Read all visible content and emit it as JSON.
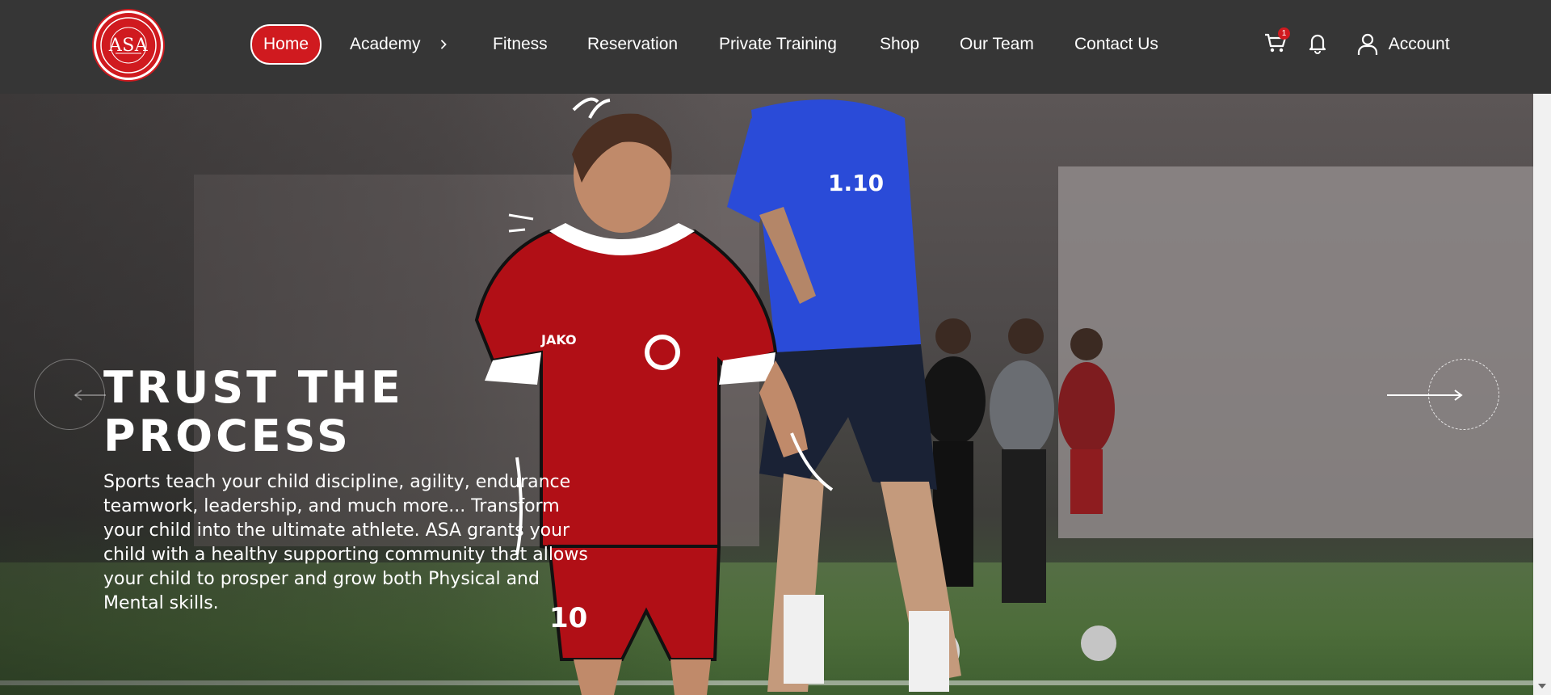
{
  "brand": {
    "logo_text": "ASA",
    "logo_ring_text": "ADVANCED SPORTS ACADEMY",
    "accent_color": "#d01a1f",
    "nav_bg": "#363636"
  },
  "nav": {
    "items": [
      {
        "label": "Home",
        "active": true
      },
      {
        "label": "Academy",
        "has_submenu": true
      },
      {
        "label": "Fitness"
      },
      {
        "label": "Reservation"
      },
      {
        "label": "Private Training"
      },
      {
        "label": "Shop"
      },
      {
        "label": "Our Team"
      },
      {
        "label": "Contact Us"
      }
    ],
    "cart_count": "1",
    "account_label": "Account",
    "icons": [
      "cart-icon",
      "bell-icon",
      "user-icon",
      "chevron-right-icon"
    ]
  },
  "hero": {
    "title_line1": "TRUST THE",
    "title_line2": "PROCESS",
    "description": "Sports teach your child discipline, agility, endurance teamwork, leadership, and much more... Transform your child into the ultimate athlete. ASA grants your child with a healthy supporting community that allows your child to prosper and grow both Physical and Mental skills.",
    "jersey_brand": "JAKO",
    "jersey_number": "10",
    "coach_shirt_text": "1.10",
    "prev_icon": "arrow-left-icon",
    "next_icon": "arrow-right-icon"
  }
}
